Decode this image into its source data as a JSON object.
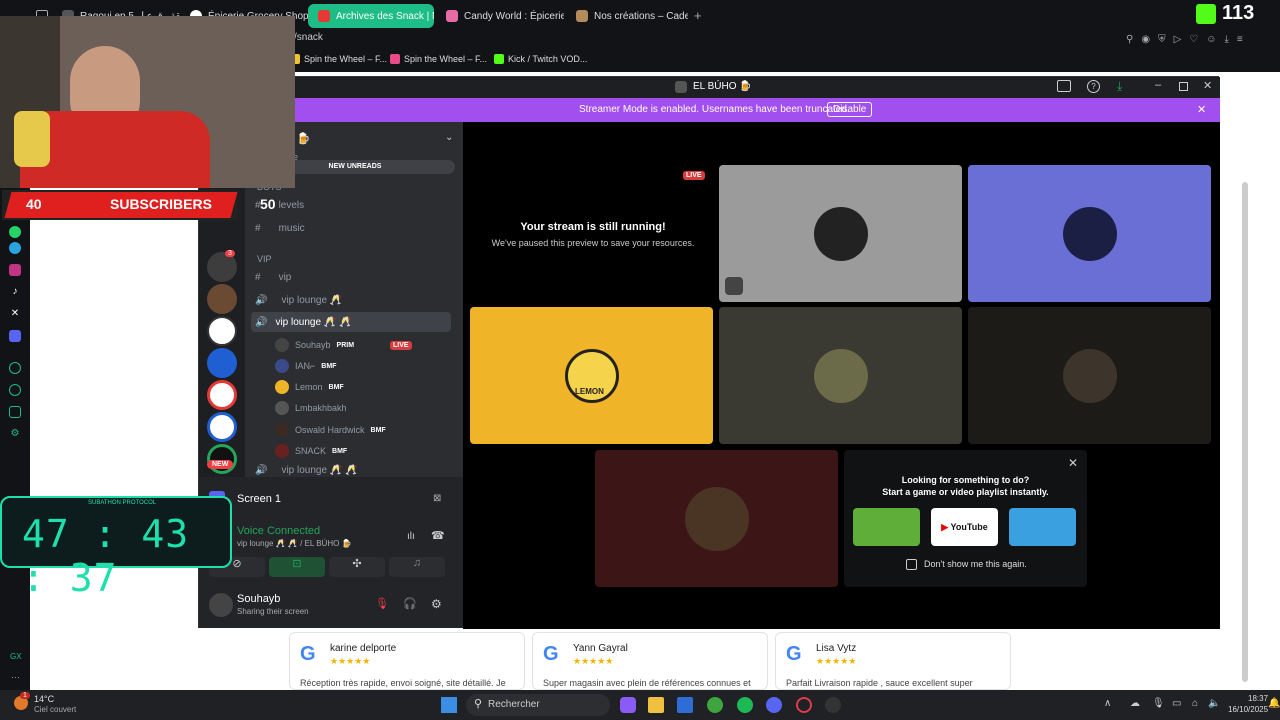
{
  "browser": {
    "tabs": [
      {
        "label": "Ragouj ep 5 الحلقة رقوع ل Ma",
        "active": false
      },
      {
        "label": "Épicerie Grocery Shop - P",
        "active": false
      },
      {
        "label": "Archives des Snack | Ma",
        "active": true
      },
      {
        "label": "Candy World : Épicerie d",
        "active": false
      },
      {
        "label": "Nos créations – Cadeau E",
        "active": false
      }
    ],
    "url": "/snack",
    "bookmarks": [
      "Spin the Wheel – F...",
      "Spin the Wheel – F...",
      "Kick / Twitch VOD..."
    ],
    "kick_count": "113",
    "gx_label": "GX"
  },
  "overlay": {
    "subscribers_count": "40",
    "subscribers_label": "SUBSCRIBERS",
    "subscribers_goal": "50",
    "timer": "47 : 43 : 37",
    "timer_label": "SUBATHON PROTOCOL"
  },
  "discord": {
    "window_title": "EL BÚHO 🍺",
    "banner_text": "Streamer Mode is enabled. Usernames have been truncated.",
    "banner_button": "Disable",
    "server_header": "O 🍺",
    "server_sub": "ree",
    "new_unreads": "NEW UNREADS",
    "categories": [
      "BOTS",
      "VIP"
    ],
    "channels": [
      {
        "name": "levels",
        "type": "text"
      },
      {
        "name": "music",
        "type": "text"
      },
      {
        "name": "vip",
        "type": "text"
      },
      {
        "name": "vip lounge 🥂",
        "type": "voice"
      },
      {
        "name": "vip lounge 🥂 🥂",
        "type": "voice",
        "selected": true
      }
    ],
    "members": [
      {
        "name": "Souhayb",
        "badge": "PRIM",
        "live": "LIVE"
      },
      {
        "name": "IAN⌐",
        "badge": "BMF"
      },
      {
        "name": "Lemon",
        "badge": "BMF"
      },
      {
        "name": "Lmbakhbakh",
        "badge": ""
      },
      {
        "name": "Oswald Hardwick",
        "badge": "BMF"
      },
      {
        "name": "SNACK",
        "badge": "BMF"
      }
    ],
    "next_channel": "vip lounge 🥂 🥂",
    "new_badge": "NEW",
    "server_badge": "3",
    "screen_label": "Screen 1",
    "voice_status": "Voice Connected",
    "voice_channel": "vip lounge 🥂 🥂 / EL BÚHO 🍺",
    "user_name": "Souhayb",
    "user_status": "Sharing their screen",
    "stage": {
      "live_tag": "LIVE",
      "stream_title": "Your stream is still running!",
      "stream_sub": "We've paused this preview to save your resources.",
      "tile_label": "LEMON",
      "activity_title": "Looking for something to do?",
      "activity_sub": "Start a game or video playlist instantly.",
      "youtube_label": "YouTube",
      "dont_show": "Don't show me this again."
    }
  },
  "reviews": [
    {
      "name": "karine delporte",
      "stars": "★★★★★",
      "text": "Réception très rapide, envoi soigné, site détaillé. Je"
    },
    {
      "name": "Yann Gayral",
      "stars": "★★★★★",
      "text": "Super magasin avec plein de références connues et"
    },
    {
      "name": "Lisa Vytz",
      "stars": "★★★★★",
      "text": "Parfait Livraison rapide , sauce excellent super"
    }
  ],
  "taskbar": {
    "weather_temp": "14°C",
    "weather_desc": "Ciel couvert",
    "search_placeholder": "Rechercher",
    "time": "18:37",
    "date": "16/10/2025",
    "notification_count": "1"
  },
  "colors": {
    "active_tab": "#1ebd86",
    "banner": "#a24ff0",
    "timer_green": "#1ee0ac",
    "live_red": "#d83c3e",
    "voice_green": "#23a55a"
  }
}
